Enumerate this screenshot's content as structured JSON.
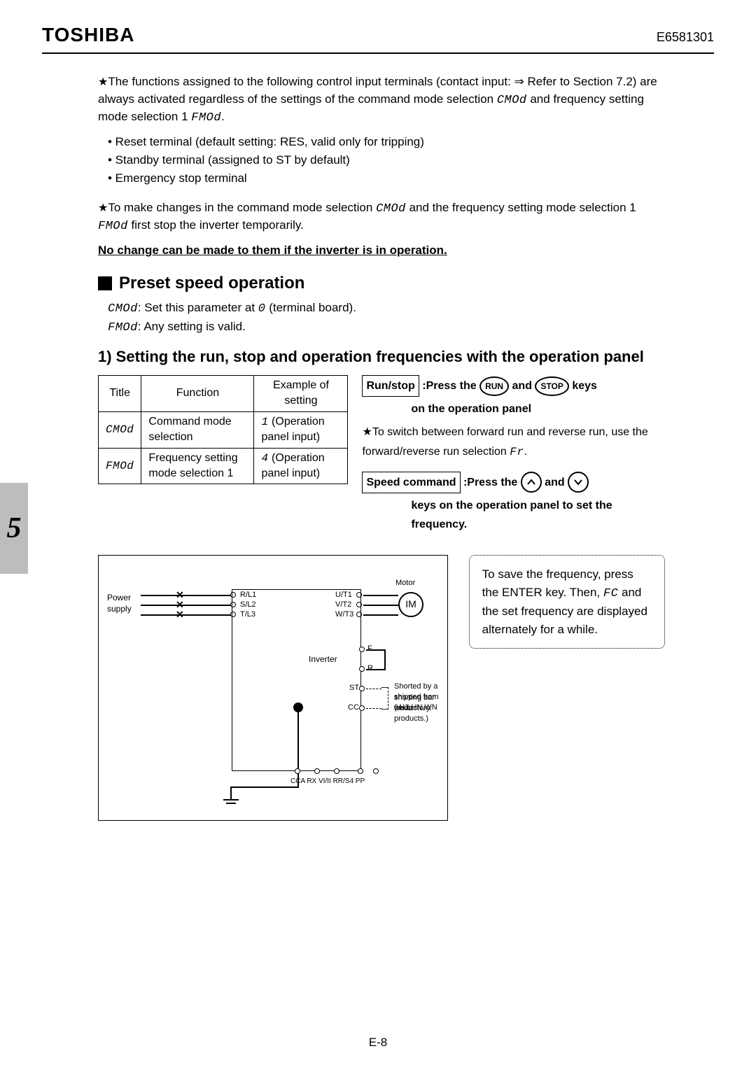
{
  "header": {
    "brand": "TOSHIBA",
    "docid": "E6581301"
  },
  "section_tab": "5",
  "para1_a": "The functions assigned to the following control input terminals (contact input: ⇒ Refer to Section 7.2) are always activated regardless of the settings of the command mode selection ",
  "seg_cmod": "CMOd",
  "para1_b": " and frequency setting mode selection 1 ",
  "seg_fmod": "FMOd",
  "para1_c": ".",
  "bullets": {
    "b1": "• Reset terminal (default setting: RES, valid only for tripping)",
    "b2": "• Standby terminal (assigned to ST by default)",
    "b3": "• Emergency stop terminal"
  },
  "para2_a": "To make changes in the command mode selection ",
  "para2_b": " and the frequency setting mode selection 1 ",
  "para2_c": " first stop the inverter temporarily.",
  "warn": "No change can be made to them if the inverter is in operation.",
  "h2": "Preset speed operation",
  "line_cmod": ": Set this parameter at ",
  "seg_zero": "0",
  "line_cmod_b": " (terminal board).",
  "line_fmod": ": Any setting is valid.",
  "h3": "1) Setting the run, stop and operation frequencies with the operation panel",
  "table": {
    "headers": {
      "c1": "Title",
      "c2": "Function",
      "c3": "Example of setting"
    },
    "rows": [
      {
        "title": "CMOd",
        "func": "Command mode selection",
        "ex_seg": "1",
        "ex_txt": " (Operation panel input)"
      },
      {
        "title": "FMOd",
        "func": "Frequency setting mode selection 1",
        "ex_seg": "4",
        "ex_txt": " (Operation panel input)"
      }
    ]
  },
  "right": {
    "runstop_box": "Run/stop",
    "runstop_a": ":Press the",
    "btn_run": "RUN",
    "and": "and",
    "btn_stop": "STOP",
    "keys": "keys",
    "runstop_b": "on the operation panel",
    "fr_a": "To switch between forward run and reverse run, use the forward/reverse run selection ",
    "seg_fr": "Fr",
    "fr_b": ".",
    "speed_box": "Speed command",
    "speed_a": ":Press the",
    "speed_b": "keys on the operation panel to set the frequency."
  },
  "note": {
    "a": "To save the frequency, press the ENTER key. Then, ",
    "seg_fc": "FC",
    "b": " and the set frequency are displayed alternately for a while."
  },
  "diagram": {
    "power": "Power",
    "supply": "supply",
    "rl1": "R/L1",
    "sl2": "S/L2",
    "tl3": "T/L3",
    "ut1": "U/T1",
    "vt2": "V/T2",
    "wt3": "W/T3",
    "motor": "Motor",
    "im": "IM",
    "inverter": "Inverter",
    "f": "F",
    "r": "R",
    "st": "ST",
    "cc": "CC",
    "short_a": "Shorted by a shorting bar when",
    "short_b": "shipped from the factory.",
    "short_c": "(-H1,HN,WN products.)",
    "bottom": "CCA  RX  VI/II  RR/S4 PP"
  },
  "pagenum": "E-8"
}
